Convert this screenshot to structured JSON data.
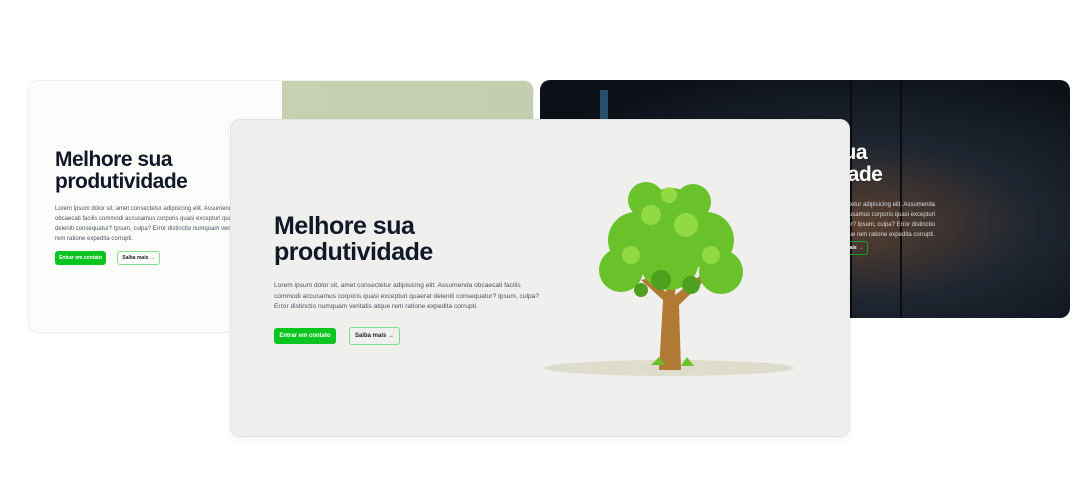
{
  "hero": {
    "title_line1": "Melhore sua",
    "title_line2": "produtividade",
    "body": "Lorem ipsum dolor sit, amet consectetur adipisicing elit. Assumenda obcaecati facilis commodi accusamus corporis quasi excepturi quaerat deleniti consequatur? Ipsum, culpa? Error distinctio numquam veritatis atque rem ratione expedita corrupti.",
    "primary_button": "Entrar em contato",
    "secondary_button": "Saiba mais →"
  },
  "colors": {
    "accent": "#0ac41f",
    "heading": "#111827"
  }
}
